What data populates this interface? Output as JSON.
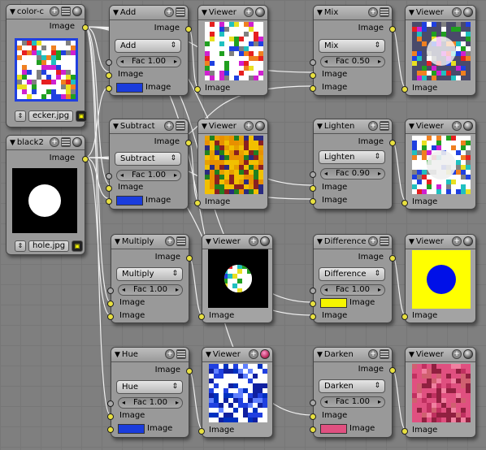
{
  "socket_label": "Image",
  "fac_label": "Fac",
  "nodes": {
    "colorc": {
      "title": "color-c",
      "output": "Image",
      "filename": "ecker.jpg"
    },
    "black2": {
      "title": "black2",
      "output": "Image",
      "filename": "hole.jpg"
    },
    "add": {
      "title": "Add",
      "mode": "Add",
      "fac": "1.00",
      "swatch": "#1a3cdc"
    },
    "subtract": {
      "title": "Subtract",
      "mode": "Subtract",
      "fac": "1.00",
      "swatch": "#1a3cdc"
    },
    "multiply": {
      "title": "Multiply",
      "mode": "Multiply",
      "fac": "1.00"
    },
    "hue": {
      "title": "Hue",
      "mode": "Hue",
      "fac": "1.00",
      "swatch": "#1a3cdc"
    },
    "mix": {
      "title": "Mix",
      "mode": "Mix",
      "fac": "0.50"
    },
    "lighten": {
      "title": "Lighten",
      "mode": "Lighten",
      "fac": "0.90"
    },
    "difference": {
      "title": "Difference",
      "mode": "Difference",
      "fac": "1.00",
      "swatch": "#f5f500"
    },
    "darken": {
      "title": "Darken",
      "mode": "Darken",
      "fac": "1.00",
      "swatch": "#e05080"
    },
    "viewer_title": "Viewer"
  },
  "colors": {
    "socket": "#e8e040",
    "checker": [
      "#ffffff",
      "#e62020",
      "#20a020",
      "#2040e0",
      "#e8e020",
      "#d020d0",
      "#20c0c0",
      "#f08020",
      "#808080"
    ]
  }
}
